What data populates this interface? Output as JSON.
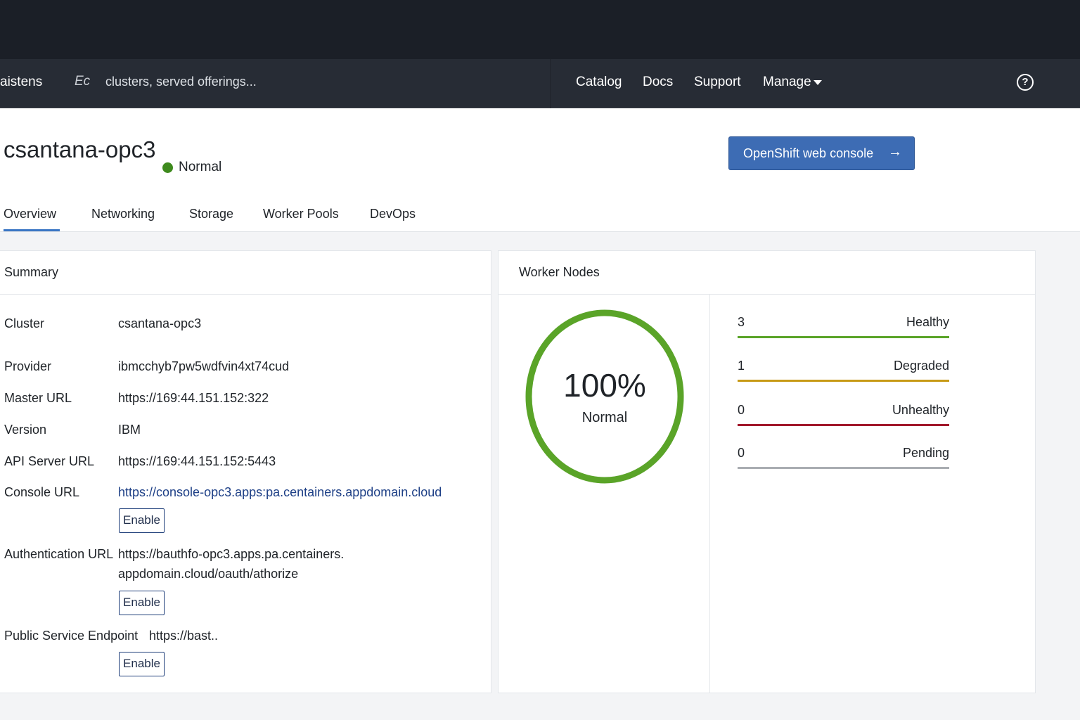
{
  "nav": {
    "brand": "aistens",
    "search_icon_text": "Ec",
    "search_placeholder": "clusters, served offerings...",
    "links": [
      "Catalog",
      "Docs",
      "Support",
      "Manage"
    ],
    "help_icon": "?"
  },
  "header": {
    "title": "csantana-opc3",
    "status": "Normal",
    "status_color": "#3e8a1d",
    "console_button": "OpenShift web console",
    "console_arrow": "→"
  },
  "tabs": [
    "Overview",
    "Networking",
    "Storage",
    "Worker Pools",
    "DevOps"
  ],
  "active_tab": "Overview",
  "summary": {
    "title": "Summary",
    "rows": [
      {
        "label": "Cluster",
        "value": "csantana-opc3"
      },
      {
        "label": "Provider",
        "value": "ibmcchyb7pw5wdfvin4xt74cud"
      },
      {
        "label": "Master URL",
        "value": "https://169:44.151.152:322"
      },
      {
        "label": "Version",
        "value": "IBM"
      },
      {
        "label": "API Server URL",
        "value": "https://169:44.151.152:5443"
      },
      {
        "label": "Console URL",
        "value": "https://console-opc3.apps:pa.centainers.appdomain.cloud"
      },
      {
        "label": "Authentication URL",
        "value": "https://bauthfo-opc3.apps.pa.centainers.",
        "value_line2": "appdomain.cloud/oauth/athorize"
      },
      {
        "label": "Public Service Endpoint",
        "value": "https://bast.."
      }
    ],
    "enable_label": "Enable"
  },
  "worker_nodes": {
    "title": "Worker Nodes",
    "gauge_percent": "100%",
    "gauge_label": "Normal",
    "gauge_fraction": 1.0,
    "gauge_color": "#5aa428",
    "states": [
      {
        "count": "3",
        "name": "Healthy",
        "color": "#5aa428"
      },
      {
        "count": "1",
        "name": "Degraded",
        "color": "#c79a16"
      },
      {
        "count": "0",
        "name": "Unhealthy",
        "color": "#a1182b"
      },
      {
        "count": "0",
        "name": "Pending",
        "color": "#a9adb2"
      }
    ]
  }
}
